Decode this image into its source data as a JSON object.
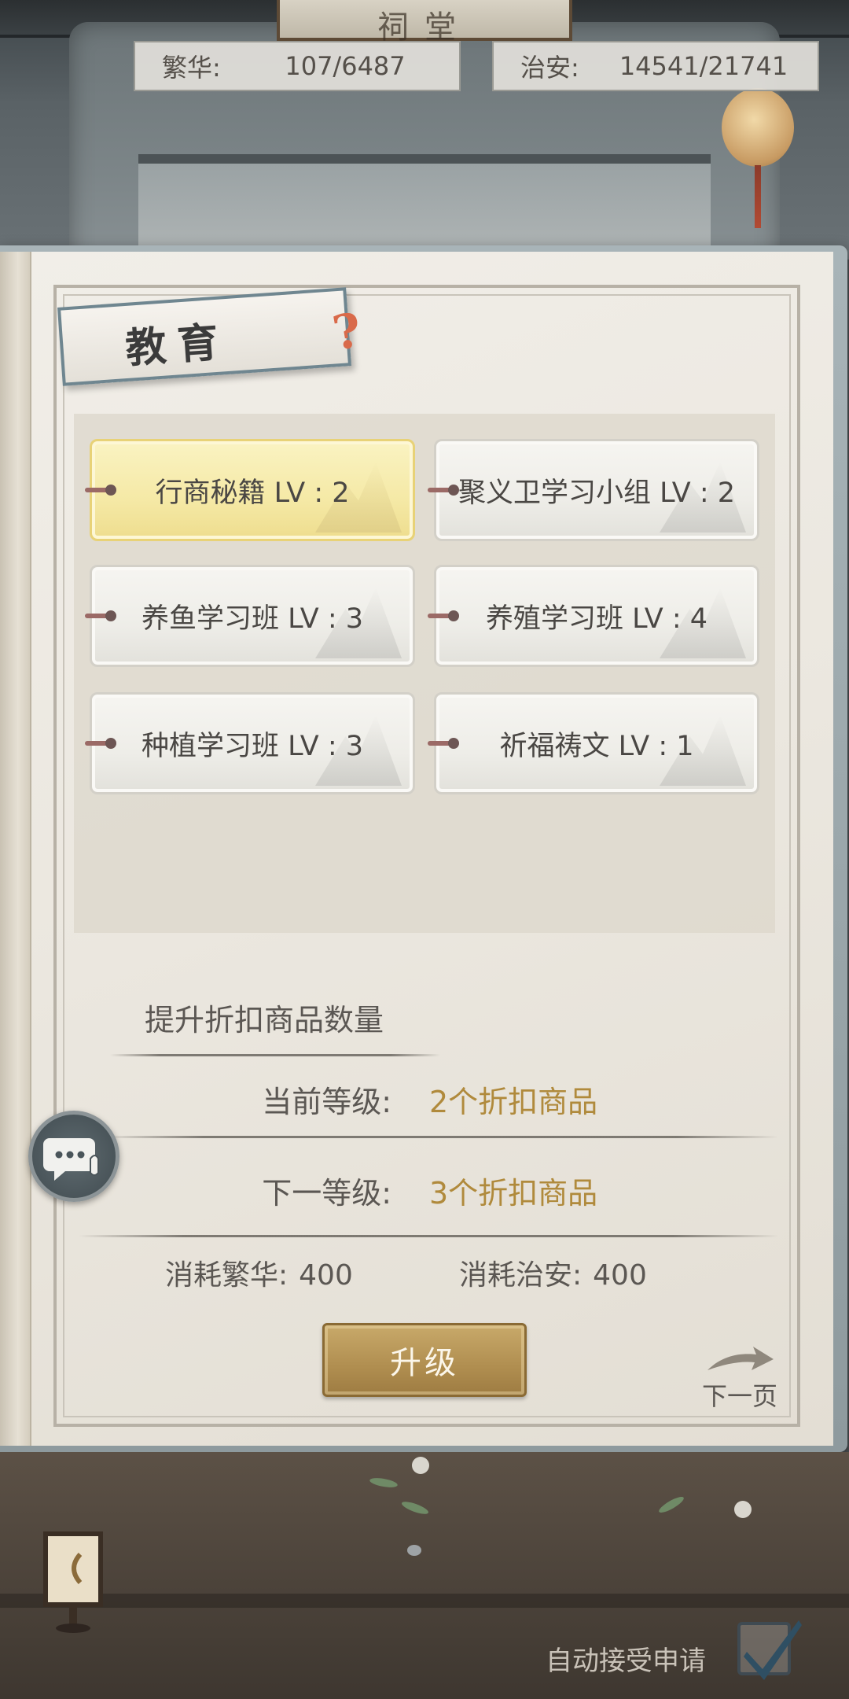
{
  "hall": {
    "plaque_text": "祠堂"
  },
  "stats": {
    "prosperity": {
      "label": "繁华:",
      "value": "107/6487"
    },
    "security": {
      "label": "治安:",
      "value": "14541/21741"
    }
  },
  "panel": {
    "title": "教育",
    "help_icon": "question-mark-icon"
  },
  "skills": [
    {
      "name": "行商秘籍 LV : 2",
      "selected": true
    },
    {
      "name": "聚义卫学习小组 LV : 2",
      "selected": false
    },
    {
      "name": "养鱼学习班 LV : 3",
      "selected": false
    },
    {
      "name": "养殖学习班 LV : 4",
      "selected": false
    },
    {
      "name": "种植学习班 LV : 3",
      "selected": false
    },
    {
      "name": "祈福祷文 LV : 1",
      "selected": false
    }
  ],
  "detail": {
    "description": "提升折扣商品数量",
    "current_label": "当前等级:",
    "current_value": "2个折扣商品",
    "next_label": "下一等级:",
    "next_value": "3个折扣商品",
    "cost_prosperity_label": "消耗繁华:",
    "cost_prosperity_value": "400",
    "cost_security_label": "消耗治安:",
    "cost_security_value": "400",
    "upgrade_button": "升级",
    "next_page": "下一页"
  },
  "footer": {
    "auto_accept_label": "自动接受申请",
    "auto_accept_checked": true
  },
  "colors": {
    "accent_gold": "#b08a3c",
    "selected_card": "#f5e9a6",
    "button_gold": "#b08e50"
  }
}
